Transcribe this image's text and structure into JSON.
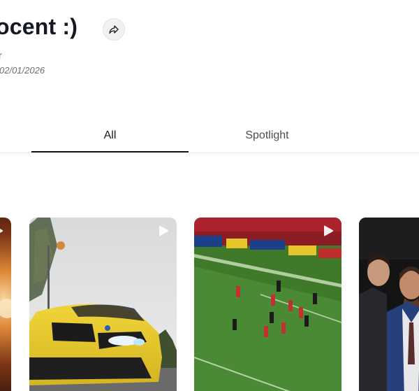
{
  "header": {
    "title": "ocent :)",
    "subtitle": "r",
    "date": "02/01/2026"
  },
  "icons": {
    "share": "share-arrow-icon",
    "play": "play-icon"
  },
  "tabs": [
    {
      "label": "All",
      "active": true
    },
    {
      "label": "Spotlight",
      "active": false
    }
  ],
  "grid": {
    "items": [
      {
        "kind": "video",
        "subject": "fire / sparks (partially visible)"
      },
      {
        "kind": "video",
        "subject": "yellow BMW car"
      },
      {
        "kind": "video",
        "subject": "football match"
      },
      {
        "kind": "video",
        "subject": "men in suits"
      }
    ]
  },
  "colors": {
    "text": "#161823",
    "tab_underline": "#161823",
    "share_bg": "#f1f1f2",
    "divider": "#e8e8ea"
  }
}
